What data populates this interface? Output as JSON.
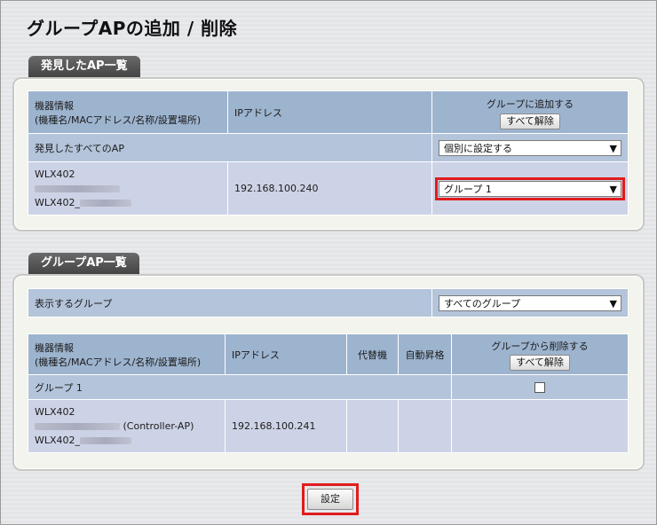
{
  "page_title": "グループAPの追加 / 削除",
  "found": {
    "tab": "発見したAP一覧",
    "header": {
      "device_info_1": "機器情報",
      "device_info_2": "(機種名/MACアドレス/名称/設置場所)",
      "ip": "IPアドレス",
      "group_add": "グループに追加する",
      "clear_all": "すべて解除"
    },
    "all_row": {
      "label": "発見したすべてのAP",
      "select_value": "個別に設定する"
    },
    "ap": {
      "model": "WLX402",
      "name_prefix": "WLX402_",
      "ip": "192.168.100.240",
      "group_value": "グループ 1"
    }
  },
  "group": {
    "tab": "グループAP一覧",
    "display_label": "表示するグループ",
    "display_value": "すべてのグループ",
    "header": {
      "device_info_1": "機器情報",
      "device_info_2": "(機種名/MACアドレス/名称/設置場所)",
      "ip": "IPアドレス",
      "substitute": "代替機",
      "auto_promote": "自動昇格",
      "group_remove": "グループから削除する",
      "clear_all": "すべて解除"
    },
    "group_row": {
      "name": "グループ 1"
    },
    "ap": {
      "model": "WLX402",
      "role": "(Controller-AP)",
      "name_prefix": "WLX402_",
      "ip": "192.168.100.241"
    }
  },
  "submit_label": "設定",
  "icons": {
    "dropdown": "chevron-down-icon"
  },
  "colors": {
    "header": "#9db4cf",
    "row": "#cdd3e6",
    "highlight": "#e01c1c"
  }
}
